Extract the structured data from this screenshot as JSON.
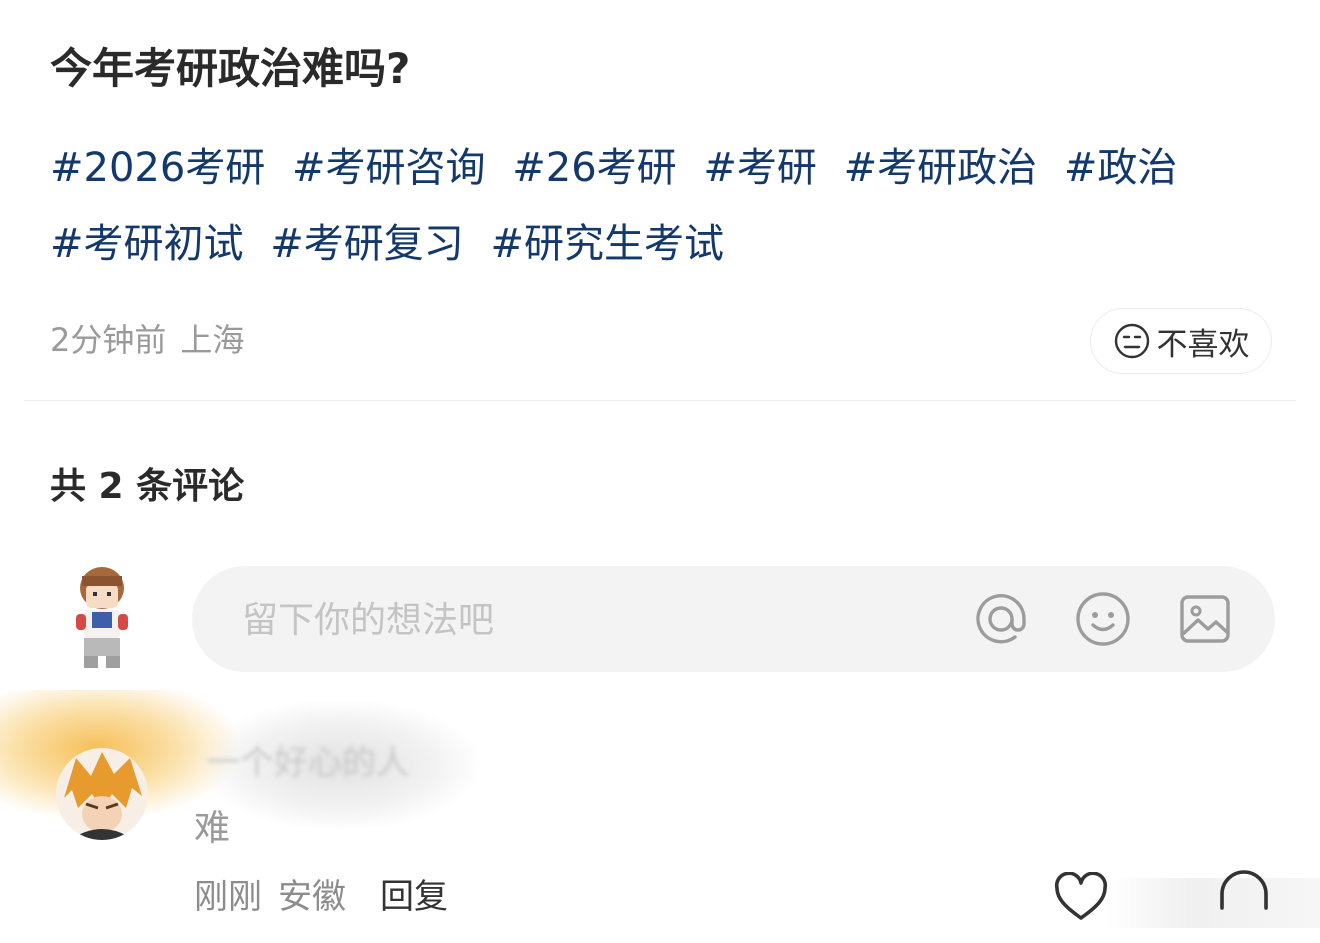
{
  "post": {
    "title": "今年考研政治难吗?",
    "tags": [
      "#2026考研",
      "#考研咨询",
      "#26考研",
      "#考研",
      "#考研政治",
      "#政治",
      "#考研初试",
      "#考研复习",
      "#研究生考试"
    ],
    "time": "2分钟前",
    "location": "上海",
    "dislike_label": "不喜欢"
  },
  "comments": {
    "count_label": "共 2 条评论",
    "input_placeholder": "留下你的想法吧",
    "icons": [
      "at-icon",
      "emoji-icon",
      "image-icon"
    ],
    "items": [
      {
        "username": "一个好心的人",
        "text": "难",
        "time": "刚刚",
        "location": "安徽",
        "reply_label": "回复"
      }
    ]
  },
  "colors": {
    "tag": "#13386c",
    "meta": "#9a9a9a",
    "input_bg": "#f3f3f3"
  }
}
